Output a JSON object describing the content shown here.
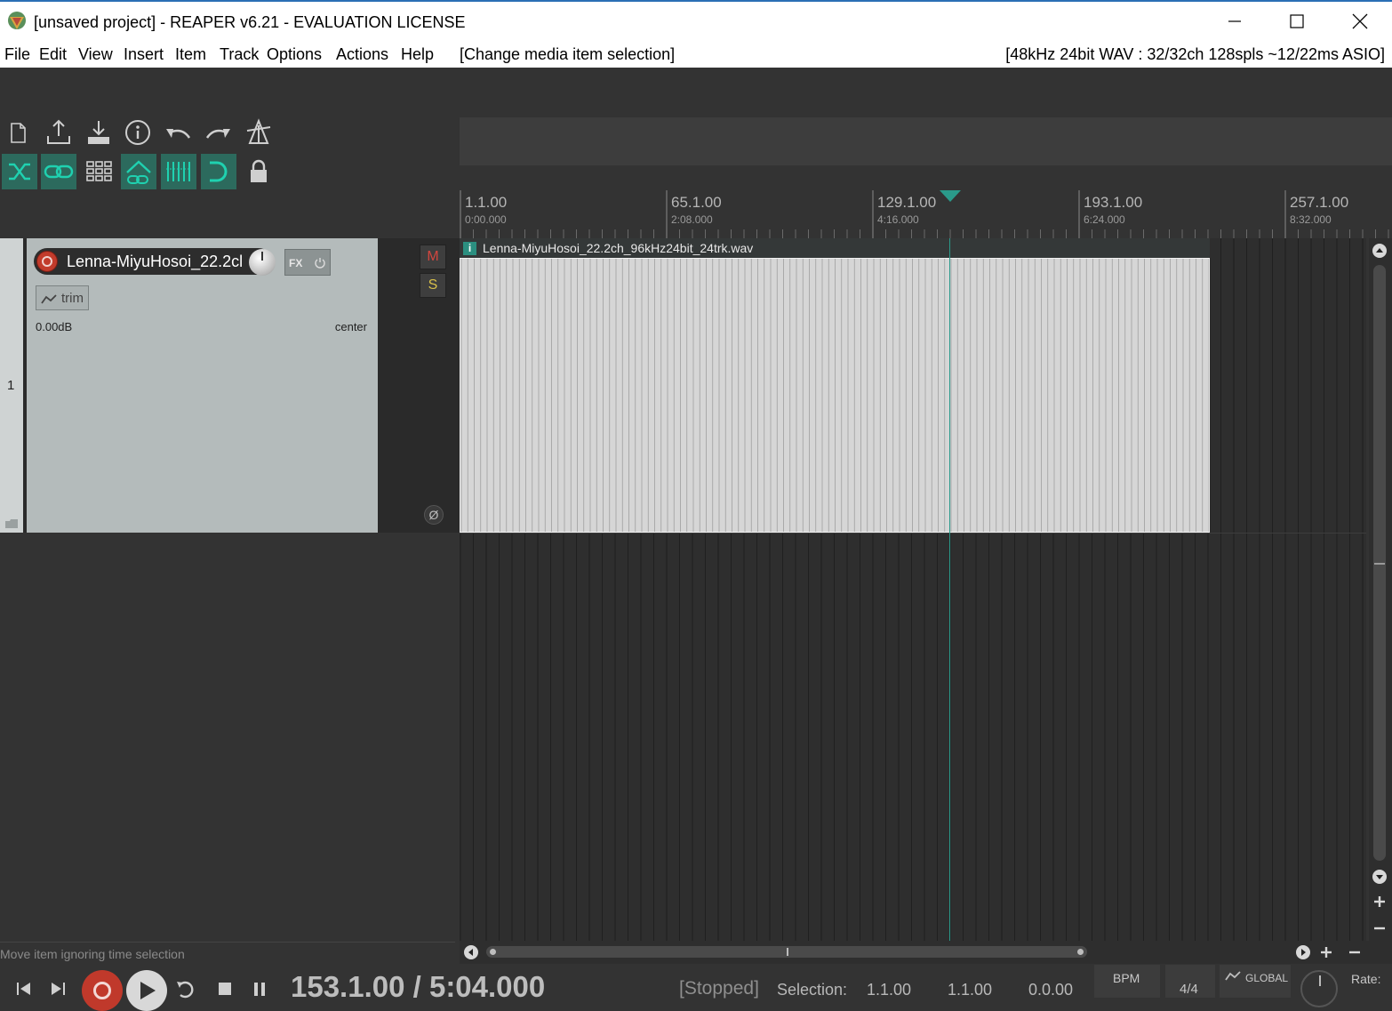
{
  "window": {
    "title": "[unsaved project] - REAPER v6.21 - EVALUATION LICENSE"
  },
  "menu": {
    "items": [
      "File",
      "Edit",
      "View",
      "Insert",
      "Item",
      "Track",
      "Options",
      "Actions",
      "Help"
    ],
    "status": "[Change media item selection]",
    "audio_info": "[48kHz 24bit WAV : 32/32ch 128spls ~12/22ms ASIO]"
  },
  "toolbar": {
    "row1": [
      "new-project-icon",
      "save-project-icon",
      "open-project-icon",
      "project-info-icon",
      "undo-icon",
      "redo-icon",
      "metronome-icon"
    ],
    "row2": [
      "ripple-edit-icon",
      "link-icon",
      "grid-icon",
      "auto-crossfade-icon",
      "snap-grid-icon",
      "loop-icon",
      "lock-icon"
    ]
  },
  "ruler": {
    "markers": [
      {
        "bar": "1.1.00",
        "time": "0:00.000"
      },
      {
        "bar": "65.1.00",
        "time": "2:08.000"
      },
      {
        "bar": "129.1.00",
        "time": "4:16.000"
      },
      {
        "bar": "193.1.00",
        "time": "6:24.000"
      },
      {
        "bar": "257.1.00",
        "time": "8:32.000"
      }
    ]
  },
  "track": {
    "number": "1",
    "name": "Lenna-MiyuHosoi_22.2cl",
    "fx_label": "FX",
    "trim_label": "trim",
    "volume": "0.00dB",
    "pan": "center",
    "mute_label": "M",
    "solo_label": "S",
    "phase_label": "Ø"
  },
  "media_item": {
    "name": "Lenna-MiyuHosoi_22.2ch_96kHz24bit_24trk.wav",
    "info_badge": "i"
  },
  "status_hint": "Move item ignoring time selection",
  "transport": {
    "position": "153.1.00 / 5:04.000",
    "state": "[Stopped]",
    "selection_label": "Selection:",
    "selection_start": "1.1.00",
    "selection_end": "1.1.00",
    "selection_length": "0.0.00",
    "bpm_label": "BPM",
    "time_signature": "4/4",
    "global_label": "GLOBAL",
    "rate_label": "Rate:"
  },
  "colors": {
    "accent": "#2c6a5d",
    "playhead": "#2a9a8a",
    "item_bg": "#d6d6d6",
    "track_panel": "#b4bbbb",
    "record": "#c0392b"
  }
}
